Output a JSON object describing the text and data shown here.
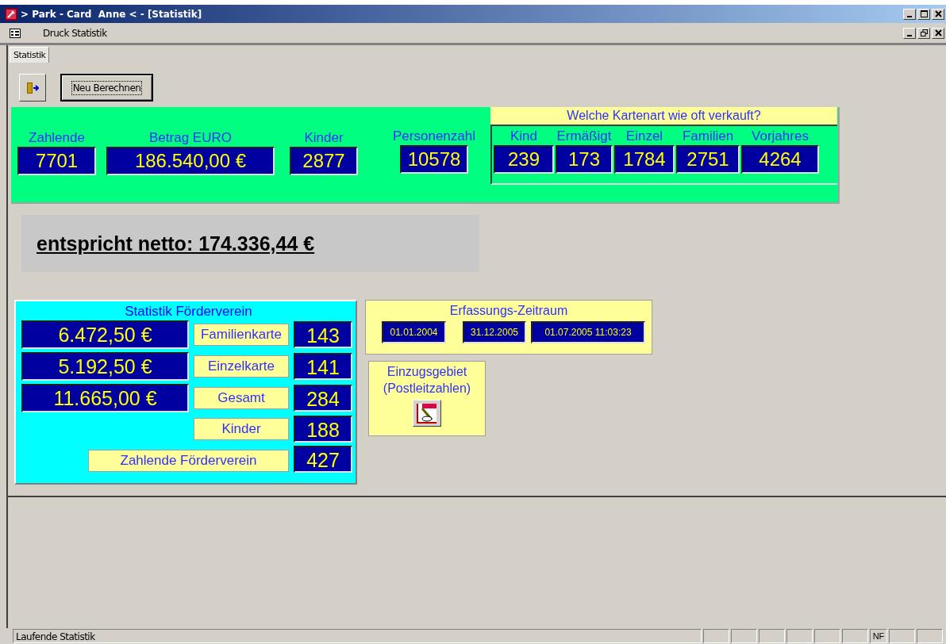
{
  "window": {
    "title": "> Park - Card  Anne < - [Statistik]"
  },
  "menu": {
    "items": [
      {
        "label": "Druck Statistik"
      }
    ]
  },
  "tabs": [
    {
      "label": "Statistik",
      "selected": true
    }
  ],
  "toolbar": {
    "recalc_button": "Neu Berechnen"
  },
  "summary": {
    "fields": [
      {
        "label": "Zahlende",
        "value": "7701"
      },
      {
        "label": "Betrag EURO",
        "value": "186.540,00 €"
      },
      {
        "label": "Kinder",
        "value": "2877"
      },
      {
        "label": "Personenzahl",
        "value": "10578"
      }
    ]
  },
  "card_types": {
    "title": "Welche Kartenart wie oft verkauft?",
    "items": [
      {
        "label": "Kind",
        "value": "239"
      },
      {
        "label": "Ermäßigt",
        "value": "173"
      },
      {
        "label": "Einzel",
        "value": "1784"
      },
      {
        "label": "Familien",
        "value": "2751"
      },
      {
        "label": "Vorjahres",
        "value": "4264"
      }
    ]
  },
  "netto": "entspricht netto: 174.336,44 €",
  "foerderverein": {
    "title": "Statistik  Förderverein",
    "rows": [
      {
        "amount": "6.472,50 €",
        "label": "Familienkarte",
        "count": "143"
      },
      {
        "amount": "5.192,50 €",
        "label": "Einzelkarte",
        "count": "141"
      },
      {
        "amount": "11.665,00 €",
        "label": "Gesamt",
        "count": "284"
      },
      {
        "label": "Kinder",
        "count": "188"
      }
    ],
    "total": {
      "label": "Zahlende Förderverein",
      "count": "427"
    }
  },
  "period": {
    "title": "Erfassungs-Zeitraum",
    "from": "01.01.2004",
    "to": "31.12.2005",
    "timestamp": "01.07.2005 11:03:23"
  },
  "region_button": {
    "label": "Einzugsgebiet (Postleitzahlen)"
  },
  "status_bar": {
    "text": "Laufende Statistik",
    "indicators": [
      "NF"
    ]
  }
}
